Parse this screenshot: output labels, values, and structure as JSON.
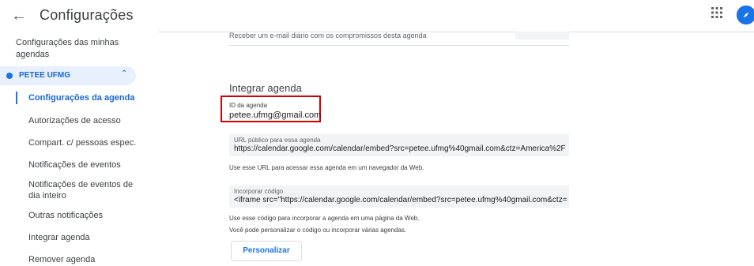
{
  "header": {
    "back_icon": "arrow-back-icon",
    "title": "Configurações",
    "apps_icon": "apps-grid-icon",
    "account_icon": "account-avatar-icon"
  },
  "sidebar": {
    "heading": "Configurações das minhas agendas",
    "calendar": {
      "label": "PETEE UFMG",
      "color": "#1a73e8",
      "expanded_icon": "chevron-up-icon"
    },
    "items": [
      {
        "label": "Configurações da agenda",
        "active": true
      },
      {
        "label": "Autorizações de acesso",
        "active": false
      },
      {
        "label": "Compart. c/ pessoas espec.",
        "active": false
      },
      {
        "label": "Notificações de eventos",
        "active": false
      },
      {
        "label": "Notificações de eventos de dia inteiro",
        "active": false
      },
      {
        "label": "Outras notificações",
        "active": false
      },
      {
        "label": "Integrar agenda",
        "active": false
      },
      {
        "label": "Remover agenda",
        "active": false
      }
    ]
  },
  "main": {
    "top_row_text": "Receber um e-mail diário com os compromissos desta agenda",
    "section_title": "Integrar agenda",
    "calendar_id": {
      "label": "ID da agenda",
      "value": "petee.ufmg@gmail.com",
      "highlight_color": "#d50000"
    },
    "public_url": {
      "label": "URL público para essa agenda",
      "value": "https://calendar.google.com/calendar/embed?src=petee.ufmg%40gmail.com&ctz=America%2F",
      "helper": "Use esse URL para acessar essa agenda em um navegador da Web."
    },
    "embed_code": {
      "label": "Incorporar código",
      "value": "<iframe src=\"https://calendar.google.com/calendar/embed?src=petee.ufmg%40gmail.com&ctz=",
      "helper_1": "Use esse código para incorporar a agenda em uma página da Web.",
      "helper_2": "Você pode personalizar o código ou incorporar várias agendas."
    },
    "customize_label": "Personalizar"
  },
  "colors": {
    "accent": "#1a73e8",
    "active_text": "#1967d2",
    "active_bg": "#e8f0fe",
    "field_bg": "#f1f3f4"
  }
}
